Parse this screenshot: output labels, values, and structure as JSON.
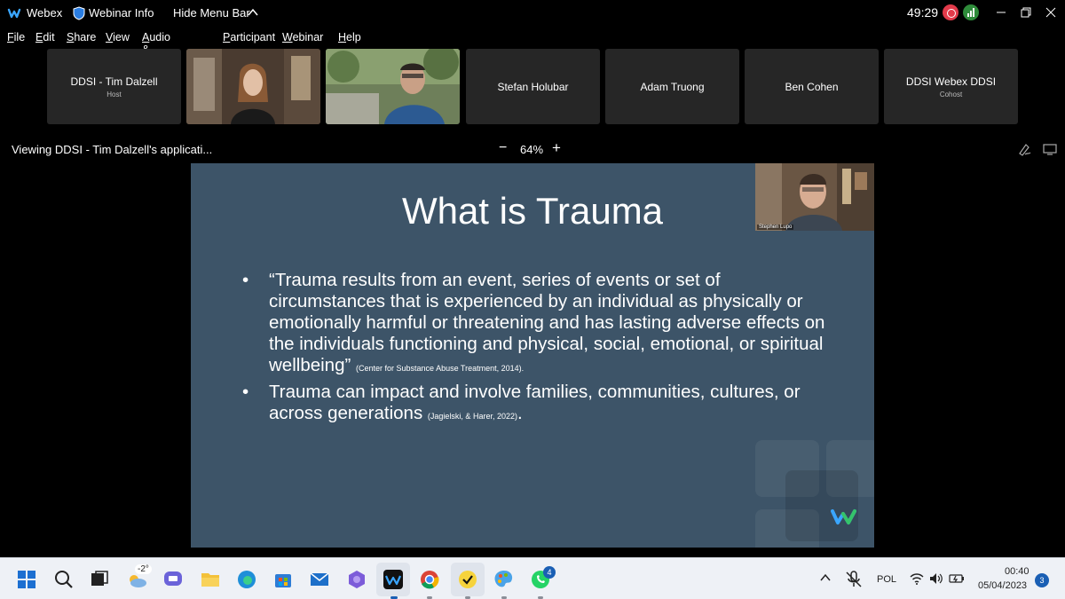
{
  "titlebar": {
    "app_name": "Webex",
    "webinar_info": "Webinar Info",
    "hide_menu": "Hide Menu Bar",
    "timer": "49:29"
  },
  "menu": [
    "File",
    "Edit",
    "Share",
    "View",
    "Audio & Video",
    "Participant",
    "Webinar",
    "Help"
  ],
  "participants": [
    {
      "name": "DDSI - Tim Dalzell",
      "role": "Host"
    },
    {
      "name": "Stefan Holubar",
      "role": ""
    },
    {
      "name": "Adam Truong",
      "role": ""
    },
    {
      "name": "Ben Cohen",
      "role": ""
    },
    {
      "name": "DDSI Webex DDSI",
      "role": "Cohost"
    }
  ],
  "share": {
    "viewing": "Viewing DDSI - Tim Dalzell's applicati...",
    "zoom_minus": "−",
    "zoom": "64%",
    "zoom_plus": "+"
  },
  "slide": {
    "title": "What is Trauma",
    "bullet1_text": "“Trauma results from an event, series of events or set of circumstances that is experienced by an individual as physically or emotionally harmful or threatening and has lasting adverse effects on the individuals functioning and physical, social, emotional, or spiritual wellbeing”",
    "bullet1_cite": "(Center for Substance Abuse Treatment, 2014).",
    "bullet2_text": "Trauma can impact and involve families, communities, cultures, or across generations",
    "bullet2_cite": "(Jagielski, & Harer, 2022)",
    "bullet2_end": ".",
    "presenter_name": "Stephen Lupo"
  },
  "taskbar": {
    "weather_temp": "-2°",
    "whatsapp_badge": "4",
    "language": "POL",
    "time": "00:40",
    "date": "05/04/2023",
    "notification_count": "3"
  },
  "colors": {
    "slide_bg": "#3d5468",
    "tile_bg": "#262626",
    "record": "#e23a4a",
    "taskbar_bg": "#eef1f6"
  }
}
